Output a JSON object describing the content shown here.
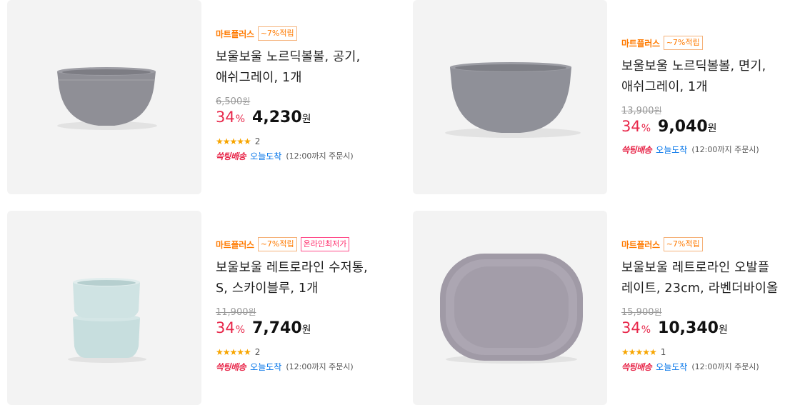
{
  "products": [
    {
      "brand": "마트플러스",
      "tags": [
        "~7%적립"
      ],
      "title1": "보울보울 노르딕볼볼, 공기,",
      "title2": "애쉬그레이, 1개",
      "original_price": "6,500",
      "won": "원",
      "discount": "34",
      "pct_sign": "%",
      "price": "4,230",
      "rating": 4.5,
      "stars": "★★★★★",
      "review_count": "2",
      "rocket": "쓱팅배송",
      "today": "오늘도착",
      "cond": "(12:00까지 주문시)",
      "bowl_color": "#8f8f96"
    },
    {
      "brand": "마트플러스",
      "tags": [
        "~7%적립"
      ],
      "title1": "보울보울 노르딕볼볼, 면기,",
      "title2": "애쉬그레이, 1개",
      "original_price": "13,900",
      "won": "원",
      "discount": "34",
      "pct_sign": "%",
      "price": "9,040",
      "rocket": "쓱팅배송",
      "today": "오늘도착",
      "cond": "(12:00까지 주문시)",
      "bowl_color": "#8f9098"
    },
    {
      "brand": "마트플러스",
      "tags": [
        "~7%적립"
      ],
      "pink_tag": "온라인최저가",
      "title1": "보울보울 레트로라인 수저통,",
      "title2": "S, 스카이블루, 1개",
      "original_price": "11,900",
      "won": "원",
      "discount": "34",
      "pct_sign": "%",
      "price": "7,740",
      "rating": 5,
      "stars": "★★★★★",
      "review_count": "2",
      "rocket": "쓱팅배송",
      "today": "오늘도착",
      "cond": "(12:00까지 주문시)",
      "cup_color": "#c7dede"
    },
    {
      "brand": "마트플러스",
      "tags": [
        "~7%적립"
      ],
      "title1": "보울보울 레트로라인 오발플",
      "title2": "레이트, 23cm, 라벤더바이올",
      "original_price": "15,900",
      "won": "원",
      "discount": "34",
      "pct_sign": "%",
      "price": "10,340",
      "rating": 5,
      "stars": "★★★★★",
      "review_count": "1",
      "rocket": "쓱팅배송",
      "today": "오늘도착",
      "cond": "(12:00까지 주문시)",
      "plate_color": "#a09aa6"
    }
  ]
}
